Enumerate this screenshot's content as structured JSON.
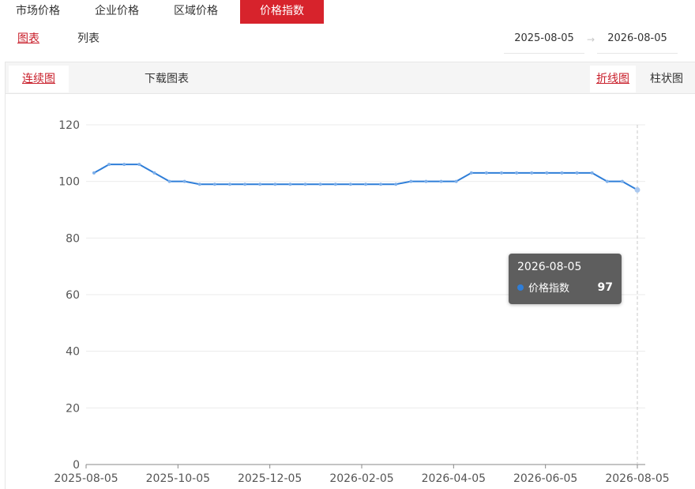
{
  "nav": {
    "tabs": [
      {
        "label": "市场价格"
      },
      {
        "label": "企业价格"
      },
      {
        "label": "区域价格"
      },
      {
        "label": "价格指数"
      }
    ],
    "active_tab": 3
  },
  "view": {
    "chart_label": "图表",
    "list_label": "列表"
  },
  "date_range": {
    "start": "2025-08-05",
    "end": "2026-08-05",
    "separator": "→"
  },
  "toolbar": {
    "continuous_label": "连续图",
    "download_label": "下载图表",
    "line_label": "折线图",
    "bar_label": "柱状图"
  },
  "tooltip": {
    "date": "2026-08-05",
    "series_name": "价格指数",
    "value": "97"
  },
  "colors": {
    "accent": "#d7232c",
    "line": "#2f7ed8"
  },
  "chart_data": {
    "type": "line",
    "x_ticks": [
      "2025-08-05",
      "2025-10-05",
      "2025-12-05",
      "2026-02-05",
      "2026-04-05",
      "2026-06-05",
      "2026-08-05"
    ],
    "y_ticks": [
      0,
      20,
      40,
      60,
      80,
      100,
      120
    ],
    "ylim": [
      0,
      120
    ],
    "grid": true,
    "series": [
      {
        "name": "价格指数",
        "values": [
          103,
          106,
          106,
          106,
          103,
          100,
          100,
          99,
          99,
          99,
          99,
          99,
          99,
          99,
          99,
          99,
          99,
          99,
          99,
          99,
          99,
          100,
          100,
          100,
          100,
          103,
          103,
          103,
          103,
          103,
          103,
          103,
          103,
          103,
          100,
          100,
          97
        ]
      }
    ]
  }
}
